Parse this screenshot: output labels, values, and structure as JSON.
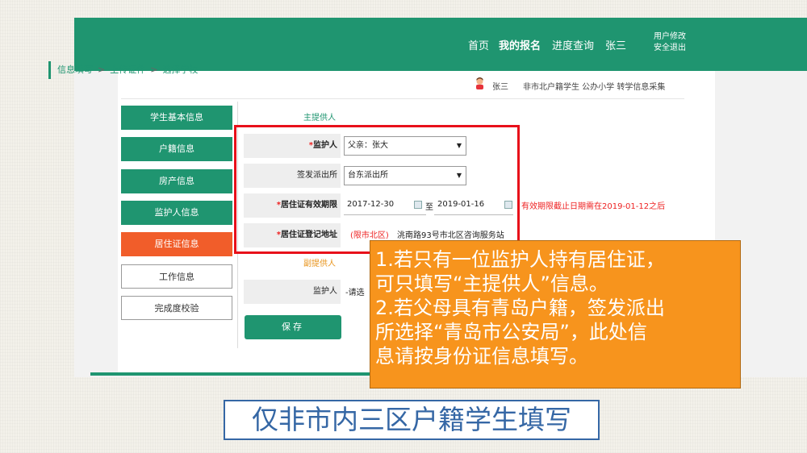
{
  "nav": {
    "home": "首页",
    "my_signup": "我的报名",
    "progress": "进度查询",
    "user": "张三"
  },
  "top_right": {
    "edit_user": "用户修改",
    "logout": "安全退出"
  },
  "breadcrumb": {
    "step1": "信息填写",
    "sep": ">",
    "step2": "上传证件",
    "step3": "选择学校"
  },
  "user_info": {
    "name": "张三",
    "desc": "非市北户籍学生 公办小学 转学信息采集"
  },
  "sidebar": [
    {
      "label": "学生基本信息"
    },
    {
      "label": "户籍信息"
    },
    {
      "label": "房产信息"
    },
    {
      "label": "监护人信息"
    },
    {
      "label": "居住证信息"
    },
    {
      "label": "工作信息"
    },
    {
      "label": "完成度校验"
    }
  ],
  "form": {
    "main_provider": "主提供人",
    "sub_provider": "副提供人",
    "guardian": {
      "required": "*",
      "label": "监护人",
      "value": "父亲：张大"
    },
    "police": {
      "label": "签发派出所",
      "value": "台东派出所"
    },
    "validity": {
      "required": "*",
      "label": "居住证有效期限",
      "start": "2017-12-30",
      "to": "至",
      "end": "2019-01-16",
      "warning": "有效期限截止日期需在2019-01-12之后"
    },
    "address": {
      "required": "*",
      "label": "居住证登记地址",
      "limit": "(限市北区)",
      "value": "洮南路93号市北区咨询服务站"
    },
    "sub_guardian": {
      "label": "监护人",
      "value": "-请选"
    },
    "save": "保存"
  },
  "callout": [
    "1.若只有一位监护人持有居住证，",
    "可只填写“主提供人”信息。",
    "2.若父母具有青岛户籍，签发派出",
    "所选择“青岛市公安局”，此处信",
    "息请按身份证信息填写。"
  ],
  "footer_note": "仅非市内三区户籍学生填写",
  "colors": {
    "green": "#1f9570",
    "orange": "#f15d2a",
    "callout": "#f7941d",
    "red": "#e8101a",
    "blue": "#3567a5"
  }
}
